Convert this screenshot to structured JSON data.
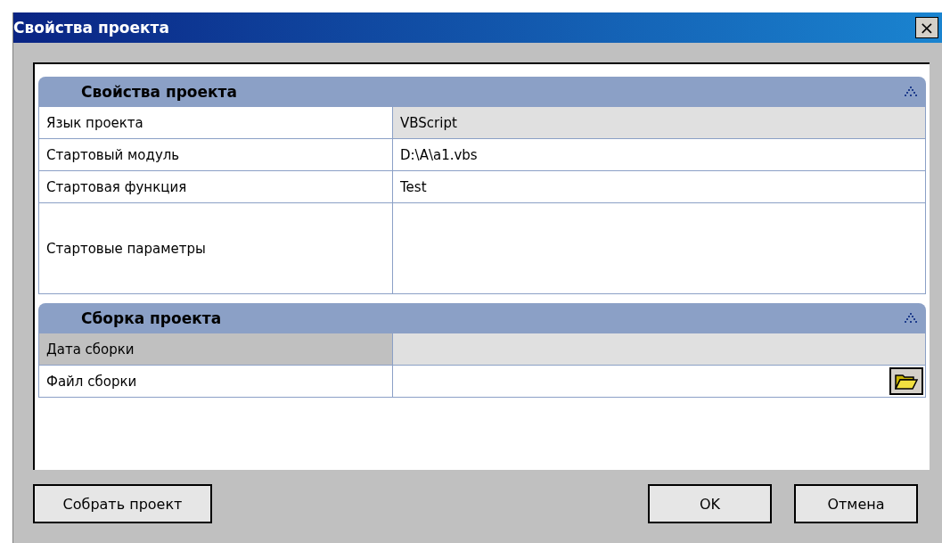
{
  "window": {
    "title": "Свойства проекта",
    "close": "×"
  },
  "sections": [
    {
      "title": "Свойства проекта",
      "rows": [
        {
          "label": "Язык проекта",
          "value": "VBScript",
          "kind": "text",
          "readonly": true,
          "disabled": false,
          "tall": false
        },
        {
          "label": "Стартовый модуль",
          "value": "D:\\A\\a1.vbs",
          "kind": "text",
          "readonly": false,
          "disabled": false,
          "tall": false
        },
        {
          "label": "Стартовая функция",
          "value": "Test",
          "kind": "text",
          "readonly": false,
          "disabled": false,
          "tall": false
        },
        {
          "label": "Стартовые параметры",
          "kind": "text",
          "readonly": false,
          "disabled": false,
          "tall": true
        }
      ]
    },
    {
      "title": "Сборка проекта",
      "rows": [
        {
          "label": "Дата сборки",
          "kind": "text",
          "readonly": true,
          "disabled": true,
          "tall": false
        },
        {
          "label": "Файл сборки",
          "kind": "file",
          "readonly": false,
          "disabled": false,
          "tall": false
        }
      ]
    }
  ],
  "buttons": [
    {
      "label": "Собрать проект",
      "kind": "left"
    },
    {
      "label": "OK",
      "kind": "right"
    },
    {
      "label": "Отмена",
      "kind": "right"
    }
  ]
}
